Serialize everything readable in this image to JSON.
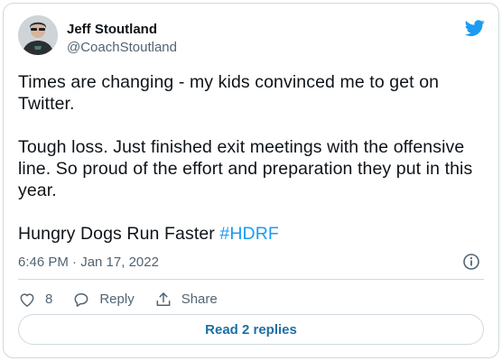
{
  "author": {
    "name": "Jeff Stoutland",
    "handle": "@CoachStoutland"
  },
  "tweet": {
    "paragraphs": [
      "Times are changing - my kids convinced me to get on Twitter.",
      "Tough loss. Just finished exit meetings with the offensive line. So proud of the effort and preparation they put in this year."
    ],
    "closing_text": "Hungry Dogs Run Faster ",
    "hashtag": "#HDRF",
    "timestamp": "6:46 PM · Jan 17, 2022"
  },
  "actions": {
    "like_count": "8",
    "reply_label": "Reply",
    "share_label": "Share"
  },
  "read_replies_label": "Read 2 replies",
  "icons": {
    "brand": "twitter-bird-icon",
    "info": "info-icon",
    "like": "heart-icon",
    "reply": "speech-bubble-icon",
    "share": "share-icon"
  },
  "colors": {
    "accent": "#1d9bf0",
    "link": "#1d6fa5",
    "muted": "#536471",
    "border": "#cfd9de"
  }
}
